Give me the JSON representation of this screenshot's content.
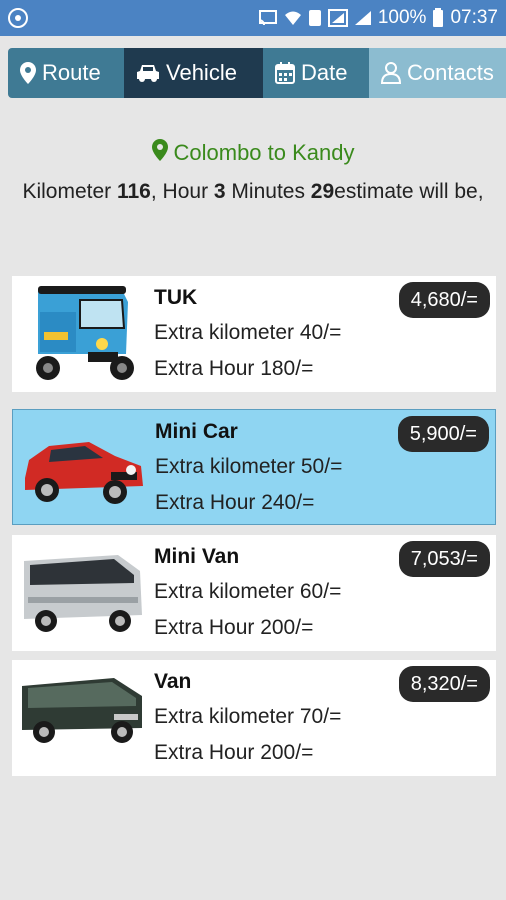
{
  "status_bar": {
    "battery_percent": "100%",
    "time": "07:37"
  },
  "tabs": [
    {
      "label": "Route",
      "icon": "map-marker-icon"
    },
    {
      "label": "Vehicle",
      "icon": "car-icon"
    },
    {
      "label": "Date",
      "icon": "calendar-icon"
    },
    {
      "label": "Contacts",
      "icon": "user-icon"
    }
  ],
  "route": {
    "text": "Colombo to Kandy",
    "color": "#3a8a1c"
  },
  "estimate": {
    "km_label": "Kilometer ",
    "km_value": "116",
    "hour_label": ", Hour ",
    "hour_value": "3",
    "minutes_label": " Minutes ",
    "minutes_value": "29",
    "tail": "estimate will be,"
  },
  "vehicles": [
    {
      "name": "TUK",
      "extra_km": "Extra kilometer 40/=",
      "extra_hour": "Extra Hour 180/=",
      "price": "4,680/=",
      "selected": false
    },
    {
      "name": "Mini Car",
      "extra_km": "Extra kilometer 50/=",
      "extra_hour": "Extra Hour 240/=",
      "price": "5,900/=",
      "selected": true
    },
    {
      "name": "Mini Van",
      "extra_km": "Extra kilometer 60/=",
      "extra_hour": "Extra Hour 200/=",
      "price": "7,053/=",
      "selected": false
    },
    {
      "name": "Van",
      "extra_km": "Extra kilometer 70/=",
      "extra_hour": "Extra Hour 200/=",
      "price": "8,320/=",
      "selected": false
    }
  ],
  "colors": {
    "status_bar": "#4b83c3",
    "tab_active": "#1f3a4f",
    "tab_normal": "#3f7a94",
    "selected_card": "#8fd5f2"
  }
}
